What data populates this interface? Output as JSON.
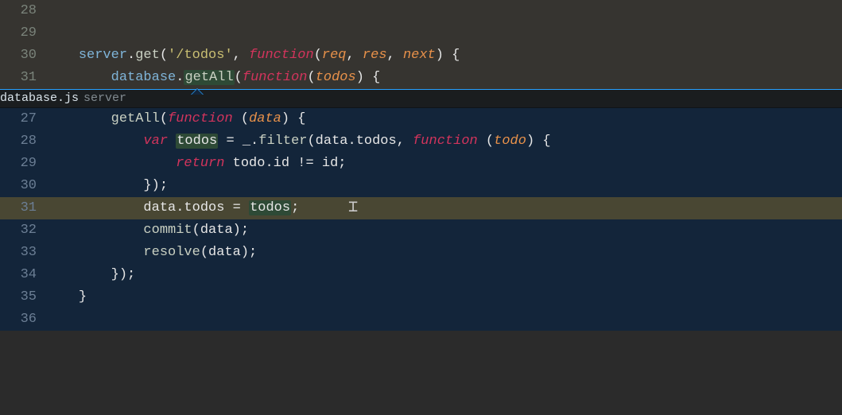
{
  "topPane": {
    "lines": [
      {
        "num": "28",
        "tokens": []
      },
      {
        "num": "29",
        "tokens": []
      },
      {
        "num": "30",
        "tokens": [
          {
            "t": "server",
            "c": "id1"
          },
          {
            "t": ".",
            "c": "p"
          },
          {
            "t": "get",
            "c": "call"
          },
          {
            "t": "(",
            "c": "p"
          },
          {
            "t": "'/todos'",
            "c": "str"
          },
          {
            "t": ", ",
            "c": "p"
          },
          {
            "t": "function",
            "c": "kw"
          },
          {
            "t": "(",
            "c": "p"
          },
          {
            "t": "req",
            "c": "prm"
          },
          {
            "t": ", ",
            "c": "p"
          },
          {
            "t": "res",
            "c": "prm"
          },
          {
            "t": ", ",
            "c": "p"
          },
          {
            "t": "next",
            "c": "prm"
          },
          {
            "t": ") {",
            "c": "p"
          }
        ],
        "indent": "    "
      },
      {
        "num": "31",
        "tokens": [
          {
            "t": "database",
            "c": "id1"
          },
          {
            "t": ".",
            "c": "p"
          },
          {
            "t": "getAll",
            "c": "call lh"
          },
          {
            "t": "(",
            "c": "p"
          },
          {
            "t": "function",
            "c": "kw"
          },
          {
            "t": "(",
            "c": "p"
          },
          {
            "t": "todos",
            "c": "prm"
          },
          {
            "t": ") {",
            "c": "p"
          }
        ],
        "indent": "        "
      }
    ]
  },
  "peek": {
    "file": "database.js",
    "symbol": "server",
    "lines": [
      {
        "num": "27",
        "indent": "        ",
        "tokens": [
          {
            "t": "getAll",
            "c": "call"
          },
          {
            "t": "(",
            "c": "p"
          },
          {
            "t": "function",
            "c": "kw"
          },
          {
            "t": " (",
            "c": "p"
          },
          {
            "t": "data",
            "c": "prm"
          },
          {
            "t": ") {",
            "c": "p"
          }
        ]
      },
      {
        "num": "28",
        "indent": "            ",
        "tokens": [
          {
            "t": "var",
            "c": "var"
          },
          {
            "t": " ",
            "c": "p"
          },
          {
            "t": "todos",
            "c": "p lh"
          },
          {
            "t": " = _.",
            "c": "p"
          },
          {
            "t": "filter",
            "c": "call"
          },
          {
            "t": "(data.todos, ",
            "c": "p"
          },
          {
            "t": "function",
            "c": "kw"
          },
          {
            "t": " (",
            "c": "p"
          },
          {
            "t": "todo",
            "c": "prm"
          },
          {
            "t": ") {",
            "c": "p"
          }
        ]
      },
      {
        "num": "29",
        "indent": "                ",
        "tokens": [
          {
            "t": "return",
            "c": "kw"
          },
          {
            "t": " todo.id != id;",
            "c": "p"
          }
        ]
      },
      {
        "num": "30",
        "indent": "            ",
        "tokens": [
          {
            "t": "});",
            "c": "p"
          }
        ]
      },
      {
        "num": "31",
        "indent": "            ",
        "hl": true,
        "caret": true,
        "tokens": [
          {
            "t": "data.todos",
            "c": "p"
          },
          {
            "t": " = ",
            "c": "p"
          },
          {
            "t": "todos",
            "c": "p lh"
          },
          {
            "t": ";",
            "c": "p"
          }
        ]
      },
      {
        "num": "32",
        "indent": "            ",
        "tokens": [
          {
            "t": "commit",
            "c": "call"
          },
          {
            "t": "(data);",
            "c": "p"
          }
        ]
      },
      {
        "num": "33",
        "indent": "            ",
        "tokens": [
          {
            "t": "resolve",
            "c": "call"
          },
          {
            "t": "(data);",
            "c": "p"
          }
        ]
      },
      {
        "num": "34",
        "indent": "        ",
        "tokens": [
          {
            "t": "});",
            "c": "p"
          }
        ]
      },
      {
        "num": "35",
        "indent": "    ",
        "tokens": [
          {
            "t": "}",
            "c": "p"
          }
        ]
      },
      {
        "num": "36",
        "indent": "",
        "tokens": []
      }
    ]
  }
}
